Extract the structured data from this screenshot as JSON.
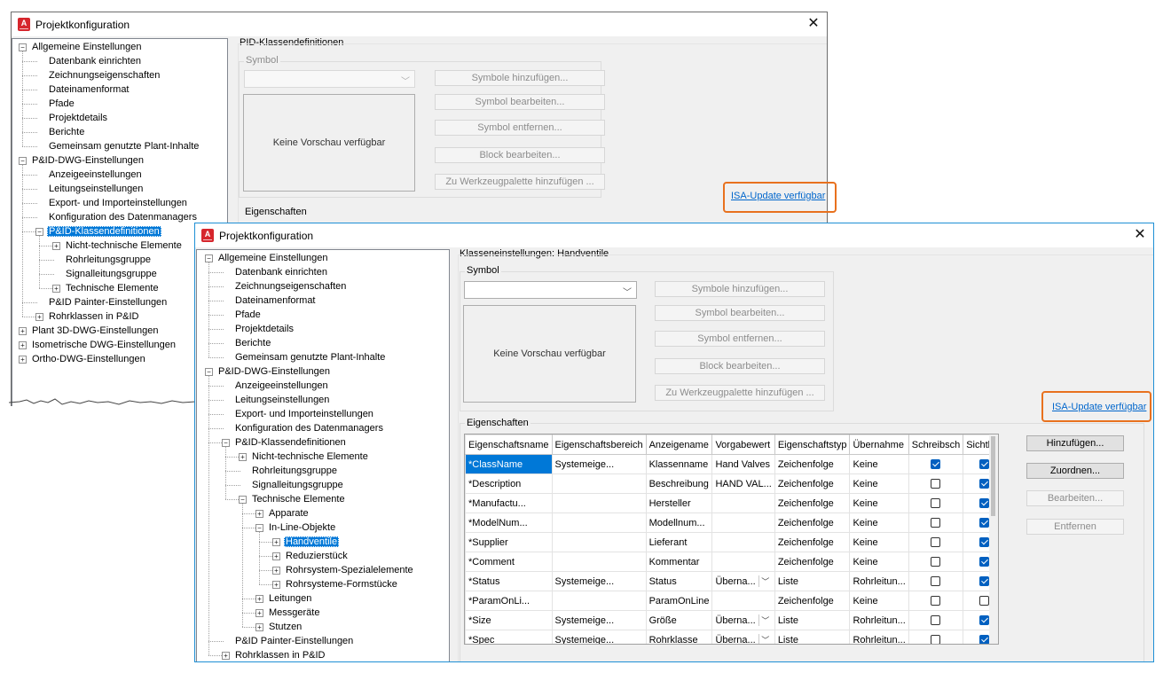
{
  "window1": {
    "title": "Projektkonfiguration",
    "tree": [
      {
        "label": "Allgemeine Einstellungen",
        "level": 0,
        "expander": "minus"
      },
      {
        "label": "Datenbank einrichten",
        "level": 1
      },
      {
        "label": "Zeichnungseigenschaften",
        "level": 1
      },
      {
        "label": "Dateinamenformat",
        "level": 1
      },
      {
        "label": "Pfade",
        "level": 1
      },
      {
        "label": "Projektdetails",
        "level": 1
      },
      {
        "label": "Berichte",
        "level": 1
      },
      {
        "label": "Gemeinsam genutzte Plant-Inhalte",
        "level": 1
      },
      {
        "label": "P&ID-DWG-Einstellungen",
        "level": 0,
        "expander": "minus"
      },
      {
        "label": "Anzeigeeinstellungen",
        "level": 1
      },
      {
        "label": "Leitungseinstellungen",
        "level": 1
      },
      {
        "label": "Export- und Importeinstellungen",
        "level": 1
      },
      {
        "label": "Konfiguration des Datenmanagers",
        "level": 1
      },
      {
        "label": "P&ID-Klassendefinitionen",
        "level": 1,
        "expander": "minus",
        "selected": true
      },
      {
        "label": "Nicht-technische Elemente",
        "level": 2,
        "expander": "plus"
      },
      {
        "label": "Rohrleitungsgruppe",
        "level": 2
      },
      {
        "label": "Signalleitungsgruppe",
        "level": 2
      },
      {
        "label": "Technische Elemente",
        "level": 2,
        "expander": "plus"
      },
      {
        "label": "P&ID Painter-Einstellungen",
        "level": 1
      },
      {
        "label": "Rohrklassen in P&ID",
        "level": 1,
        "expander": "plus"
      },
      {
        "label": "Plant 3D-DWG-Einstellungen",
        "level": 0,
        "expander": "plus"
      },
      {
        "label": "Isometrische DWG-Einstellungen",
        "level": 0,
        "expander": "plus"
      },
      {
        "label": "Ortho-DWG-Einstellungen",
        "level": 0,
        "expander": "plus"
      }
    ],
    "section_title": "PID-Klassendefinitionen",
    "symbol_label": "Symbol",
    "preview_text": "Keine Vorschau verfügbar",
    "buttons": [
      "Symbole hinzufügen...",
      "Symbol bearbeiten...",
      "Symbol entfernen...",
      "Block bearbeiten...",
      "Zu Werkzeugpalette hinzufügen ..."
    ],
    "isa_link": "ISA-Update verfügbar",
    "properties_label": "Eigenschaften"
  },
  "window2": {
    "title": "Projektkonfiguration",
    "tree": [
      {
        "label": "Allgemeine Einstellungen",
        "level": 0,
        "expander": "minus"
      },
      {
        "label": "Datenbank einrichten",
        "level": 1
      },
      {
        "label": "Zeichnungseigenschaften",
        "level": 1
      },
      {
        "label": "Dateinamenformat",
        "level": 1
      },
      {
        "label": "Pfade",
        "level": 1
      },
      {
        "label": "Projektdetails",
        "level": 1
      },
      {
        "label": "Berichte",
        "level": 1
      },
      {
        "label": "Gemeinsam genutzte Plant-Inhalte",
        "level": 1
      },
      {
        "label": "P&ID-DWG-Einstellungen",
        "level": 0,
        "expander": "minus"
      },
      {
        "label": "Anzeigeeinstellungen",
        "level": 1
      },
      {
        "label": "Leitungseinstellungen",
        "level": 1
      },
      {
        "label": "Export- und Importeinstellungen",
        "level": 1
      },
      {
        "label": "Konfiguration des Datenmanagers",
        "level": 1
      },
      {
        "label": "P&ID-Klassendefinitionen",
        "level": 1,
        "expander": "minus"
      },
      {
        "label": "Nicht-technische Elemente",
        "level": 2,
        "expander": "plus"
      },
      {
        "label": "Rohrleitungsgruppe",
        "level": 2
      },
      {
        "label": "Signalleitungsgruppe",
        "level": 2
      },
      {
        "label": "Technische Elemente",
        "level": 2,
        "expander": "minus"
      },
      {
        "label": "Apparate",
        "level": 3,
        "expander": "plus"
      },
      {
        "label": "In-Line-Objekte",
        "level": 3,
        "expander": "minus"
      },
      {
        "label": "Handventile",
        "level": 4,
        "expander": "plus",
        "selected": true
      },
      {
        "label": "Reduzierstück",
        "level": 4,
        "expander": "plus"
      },
      {
        "label": "Rohrsystem-Spezialelemente",
        "level": 4,
        "expander": "plus"
      },
      {
        "label": "Rohrsysteme-Formstücke",
        "level": 4,
        "expander": "plus"
      },
      {
        "label": "Leitungen",
        "level": 3,
        "expander": "plus"
      },
      {
        "label": "Messgeräte",
        "level": 3,
        "expander": "plus"
      },
      {
        "label": "Stutzen",
        "level": 3,
        "expander": "plus"
      },
      {
        "label": "P&ID Painter-Einstellungen",
        "level": 1
      },
      {
        "label": "Rohrklassen in P&ID",
        "level": 1,
        "expander": "plus"
      }
    ],
    "section_title": "Klasseneinstellungen: Handventile",
    "symbol_label": "Symbol",
    "preview_text": "Keine Vorschau verfügbar",
    "buttons": [
      "Symbole hinzufügen...",
      "Symbol bearbeiten...",
      "Symbol entfernen...",
      "Block bearbeiten...",
      "Zu Werkzeugpalette hinzufügen ..."
    ],
    "isa_link": "ISA-Update verfügbar",
    "properties_label": "Eigenschaften",
    "table": {
      "columns": [
        "Eigenschaftsname",
        "Eigenschaftsbereich",
        "Anzeigename",
        "Vorgabewert",
        "Eigenschaftstyp",
        "Übernahme",
        "Schreibsch",
        "Sichtbar"
      ],
      "rows": [
        {
          "name": "*ClassName",
          "scope": "Systemeige...",
          "display": "Klassenname",
          "default": "Hand Valves",
          "default_dropdown": false,
          "type": "Zeichenfolge",
          "inherit": "Keine",
          "readonly": true,
          "visible": true,
          "selected": true
        },
        {
          "name": "*Description",
          "scope": "",
          "display": "Beschreibung",
          "default": "HAND VAL...",
          "default_dropdown": false,
          "type": "Zeichenfolge",
          "inherit": "Keine",
          "readonly": false,
          "visible": true
        },
        {
          "name": "*Manufactu...",
          "scope": "",
          "display": "Hersteller",
          "default": "",
          "default_dropdown": false,
          "type": "Zeichenfolge",
          "inherit": "Keine",
          "readonly": false,
          "visible": true
        },
        {
          "name": "*ModelNum...",
          "scope": "",
          "display": "Modellnum...",
          "default": "",
          "default_dropdown": false,
          "type": "Zeichenfolge",
          "inherit": "Keine",
          "readonly": false,
          "visible": true
        },
        {
          "name": "*Supplier",
          "scope": "",
          "display": "Lieferant",
          "default": "",
          "default_dropdown": false,
          "type": "Zeichenfolge",
          "inherit": "Keine",
          "readonly": false,
          "visible": true
        },
        {
          "name": "*Comment",
          "scope": "",
          "display": "Kommentar",
          "default": "",
          "default_dropdown": false,
          "type": "Zeichenfolge",
          "inherit": "Keine",
          "readonly": false,
          "visible": true
        },
        {
          "name": "*Status",
          "scope": "Systemeige...",
          "display": "Status",
          "default": "Überna...",
          "default_dropdown": true,
          "type": "Liste",
          "inherit": "Rohrleitun...",
          "readonly": false,
          "visible": true
        },
        {
          "name": "*ParamOnLi...",
          "scope": "",
          "display": "ParamOnLine",
          "default": "",
          "default_dropdown": false,
          "type": "Zeichenfolge",
          "inherit": "Keine",
          "readonly": false,
          "visible": false
        },
        {
          "name": "*Size",
          "scope": "Systemeige...",
          "display": "Größe",
          "default": "Überna...",
          "default_dropdown": true,
          "type": "Liste",
          "inherit": "Rohrleitun...",
          "readonly": false,
          "visible": true
        },
        {
          "name": "*Spec",
          "scope": "Systemeige...",
          "display": "Rohrklasse",
          "default": "Überna...",
          "default_dropdown": true,
          "type": "Liste",
          "inherit": "Rohrleitun...",
          "readonly": false,
          "visible": true
        }
      ]
    },
    "side_buttons": {
      "add": "Hinzufügen...",
      "assign": "Zuordnen...",
      "edit": "Bearbeiten...",
      "remove": "Entfernen"
    }
  },
  "colors": {
    "highlight": "#e8711e",
    "selection": "#0078d7",
    "link": "#0066cc",
    "window_border": "#1e8fd5"
  },
  "icons": {
    "app": "autocad-plant-icon",
    "close": "close-icon"
  }
}
